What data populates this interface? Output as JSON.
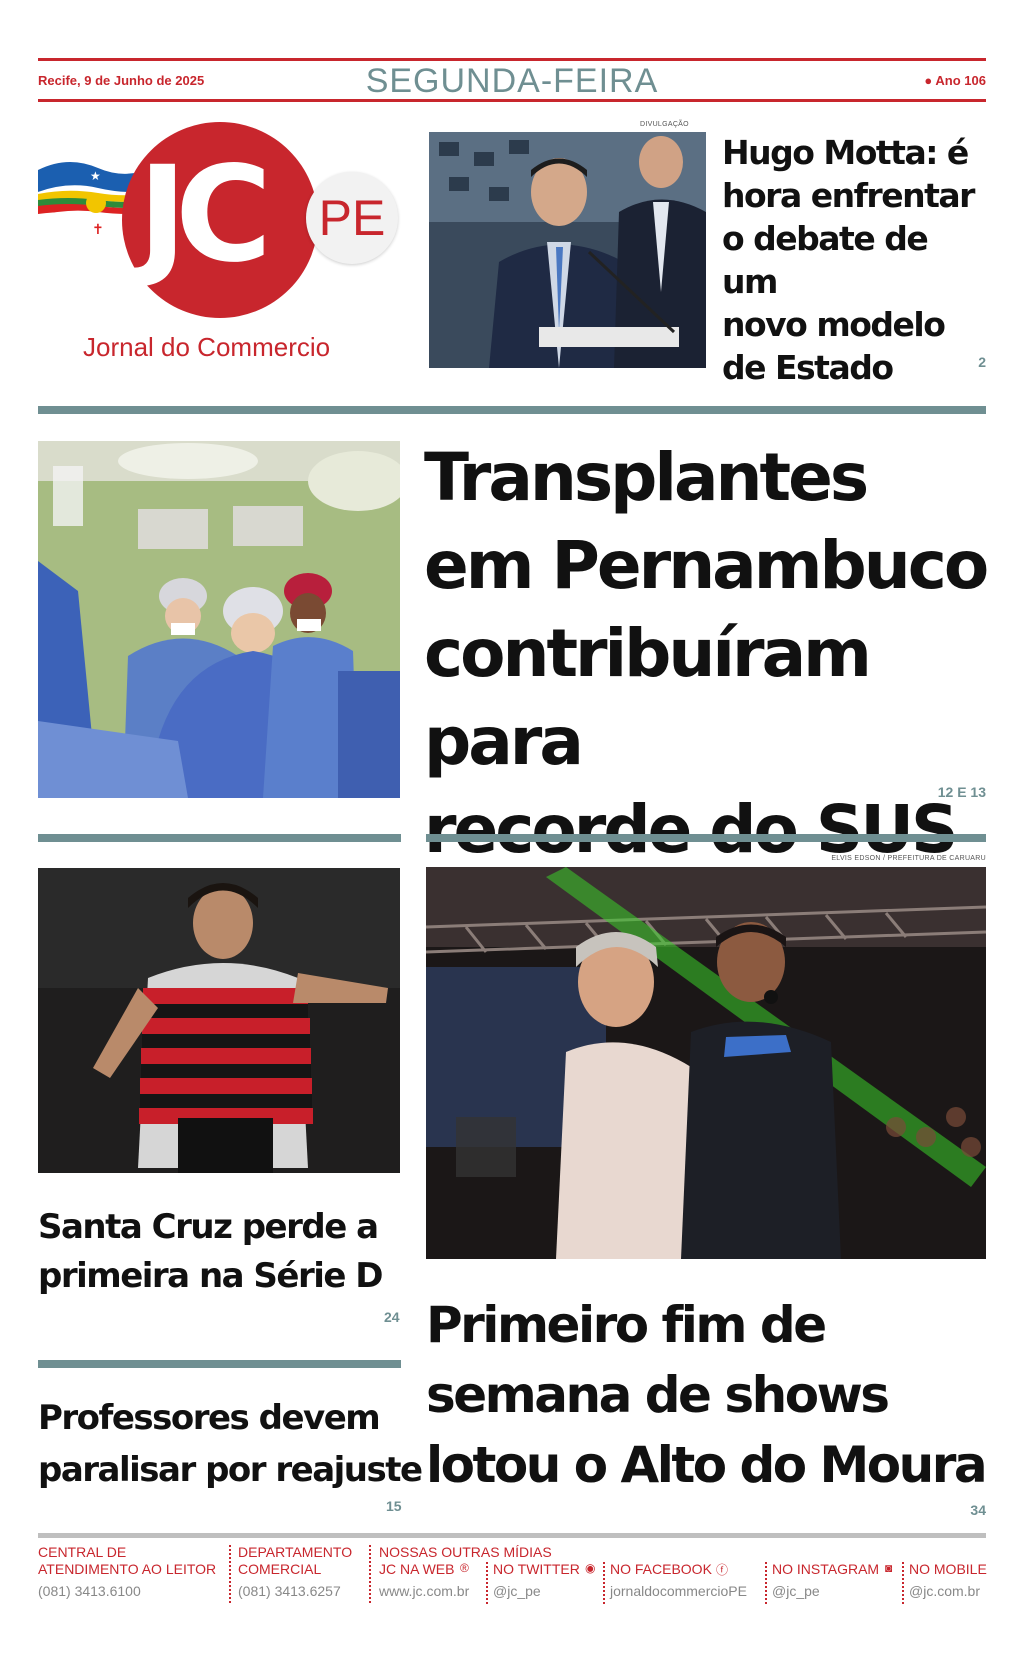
{
  "masthead": {
    "date": "Recife, 9 de Junho de 2025",
    "weekday": "SEGUNDA-FEIRA",
    "edition": "Ano 106",
    "logo_letters": "JC",
    "logo_badge": "PE",
    "logo_name": "Jornal do Commercio"
  },
  "stories": {
    "hugo": {
      "credit": "DIVULGAÇÃO",
      "lines": [
        "Hugo Motta: é",
        "hora enfrentar",
        "o debate de um",
        "novo modelo",
        "de Estado"
      ],
      "page": "2"
    },
    "transplantes": {
      "lines": [
        "Transplantes",
        "em Pernambuco",
        "contribuíram para",
        "recorde do SUS"
      ],
      "page": "12 E 13"
    },
    "santa_cruz": {
      "lines": [
        "Santa Cruz perde a",
        "primeira na Série D"
      ],
      "page": "24"
    },
    "professores": {
      "lines": [
        "Professores devem",
        "paralisar por reajuste"
      ],
      "page": "15"
    },
    "alto_do_moura": {
      "credit": "ELVIS EDSON / PREFEITURA DE CARUARU",
      "lines": [
        "Primeiro fim de",
        "semana de shows",
        "lotou o Alto do Moura"
      ],
      "page": "34"
    }
  },
  "footer": {
    "central": {
      "label1": "CENTRAL DE",
      "label2": "ATENDIMENTO AO LEITOR",
      "value": "(081) 3413.6100"
    },
    "comercial": {
      "label1": "DEPARTAMENTO",
      "label2": "COMERCIAL",
      "value": "(081) 3413.6257"
    },
    "outras": "NOSSAS OUTRAS MÍDIAS",
    "web": {
      "label": "JC NA WEB",
      "value": "www.jc.com.br"
    },
    "twitter": {
      "label": "NO TWITTER",
      "value": "@jc_pe"
    },
    "facebook": {
      "label": "NO FACEBOOK",
      "value": "jornaldocommercioPE"
    },
    "instagram": {
      "label": "NO INSTAGRAM",
      "value": "@jc_pe"
    },
    "mobile": {
      "label": "NO MOBILE",
      "value": "@jc.com.br"
    }
  },
  "colors": {
    "brand_red": "#c8262d",
    "accent_teal": "#6f8f92"
  }
}
